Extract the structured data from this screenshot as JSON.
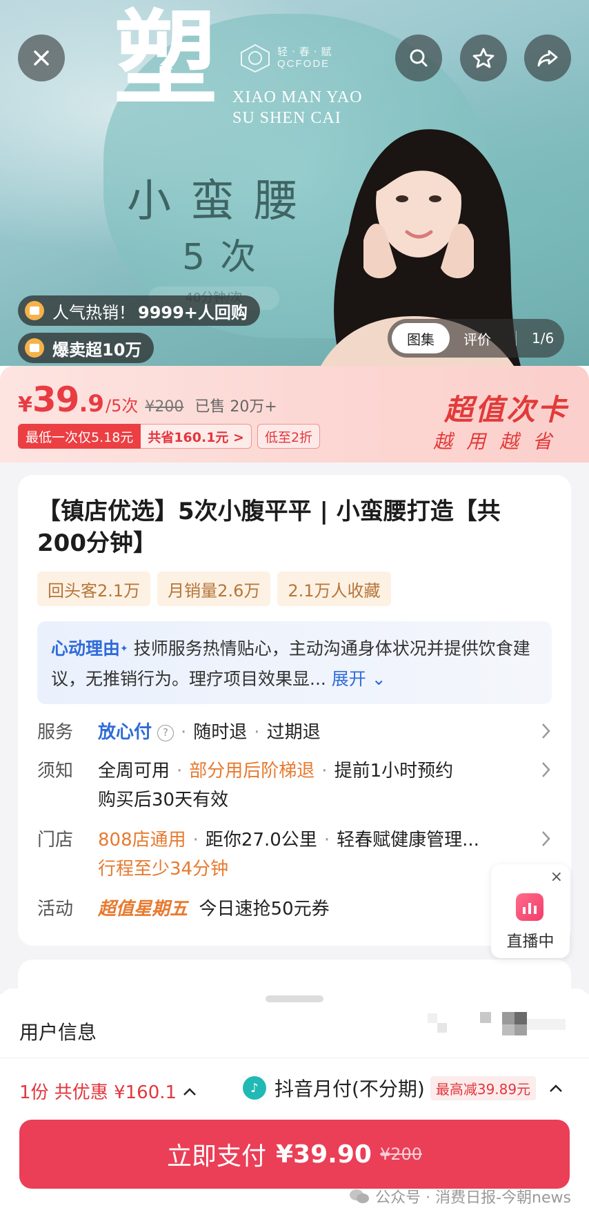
{
  "hero": {
    "big_char": "塑",
    "brand_cn": "轻·春·赋",
    "brand_en": "QCFODE",
    "en_line1": "XIAO MAN YAO",
    "en_line2": "SU SHEN CAI",
    "title": "小蛮腰",
    "times": "5次",
    "minutes": "40分钟/次",
    "badge_hot_prefix": "人气热销！",
    "badge_hot_count": "9999+人回购",
    "badge_sold": "爆卖超10万",
    "tabs": {
      "gallery": "图集",
      "reviews": "评价",
      "counter": "1/6"
    }
  },
  "price": {
    "yen": "¥",
    "main": "39",
    "decimal": ".9",
    "unit": "/5次",
    "original": "¥200",
    "sold": "已售 20万+",
    "tag_lowest": "最低一次仅5.18元",
    "tag_saving": "共省160.1元 >",
    "tag_discount": "低至2折",
    "deal_title": "超值次卡",
    "deal_sub": "越用越省"
  },
  "product": {
    "title": "【镇店优选】5次小腹平平 | 小蛮腰打造【共200分钟】",
    "chips": [
      "回头客2.1万",
      "月销量2.6万",
      "2.1万人收藏"
    ],
    "reason_label": "心动理由",
    "reason_text": "技师服务热情贴心，主动沟通身体状况并提供饮食建议，无推销行为。理疗项目效果显...",
    "reason_more": "展开"
  },
  "rows": {
    "service": {
      "label": "服务",
      "item1": "放心付",
      "item2": "随时退",
      "item3": "过期退"
    },
    "notice": {
      "label": "须知",
      "item1": "全周可用",
      "item2": "部分用后阶梯退",
      "item3": "提前1小时预约",
      "line2": "购买后30天有效"
    },
    "store": {
      "label": "门店",
      "item1": "808店通用",
      "item2": "距你27.0公里",
      "item3": "轻春赋健康管理...",
      "line2": "行程至少34分钟"
    },
    "event": {
      "label": "活动",
      "item1": "超值星期五",
      "item2": "今日速抢50元券"
    }
  },
  "live": {
    "label": "直播中",
    "close": "×"
  },
  "sheet": {
    "user_info": "用户信息",
    "discount_summary": "1份 共优惠 ¥160.1",
    "pay_method": "抖音月付(不分期)",
    "pay_reduce": "最高减39.89元",
    "pay_label": "立即支付",
    "pay_amount": "¥39.90",
    "pay_original": "¥200"
  },
  "watermark": "公众号 · 消费日报-今朝news",
  "colors": {
    "accent_red": "#e2363d",
    "pay_button": "#ea3f57",
    "reason_blue": "#2f6bd8",
    "chip_text": "#b5753a"
  }
}
